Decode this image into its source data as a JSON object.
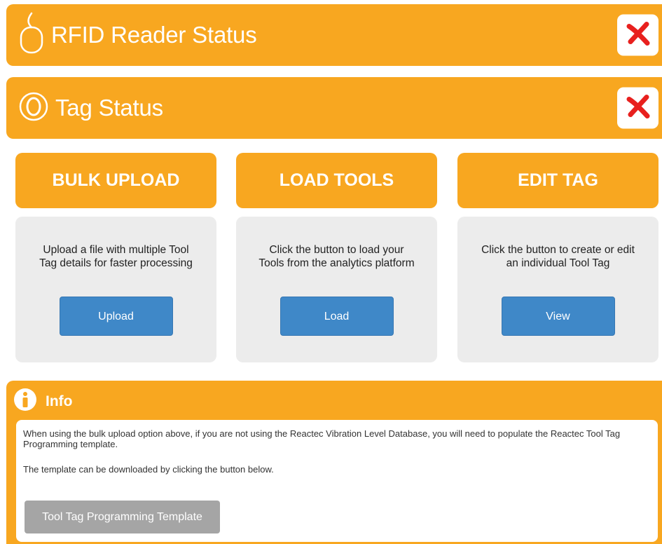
{
  "reader_status": {
    "title": "RFID Reader Status",
    "icon": "reader-icon",
    "status_icon": "red-x-icon"
  },
  "tag_status": {
    "title": "Tag Status",
    "icon": "tag-icon",
    "status_icon": "red-x-icon"
  },
  "cards": [
    {
      "title": "BULK UPLOAD",
      "line1": "Upload a file with multiple Tool",
      "line2": "Tag details for faster processing",
      "button": "Upload"
    },
    {
      "title": "LOAD TOOLS",
      "line1": "Click the button to load your",
      "line2": "Tools from the analytics platform",
      "button": "Load"
    },
    {
      "title": "EDIT TAG",
      "line1": "Click the button to create or edit",
      "line2": "an individual Tool Tag",
      "button": "View"
    }
  ],
  "info": {
    "title": "Info",
    "paragraph1": "When using the bulk upload option above, if you are not using the Reactec Vibration Level Database, you will need to populate the Reactec Tool Tag Programming template.",
    "paragraph2": "The template can be downloaded by clicking the button below.",
    "button": "Tool Tag Programming Template"
  },
  "colors": {
    "accent": "#f8a720",
    "button_blue": "#3f88c8",
    "card_bg": "#ececec",
    "error_red": "#e8201e",
    "disabled_gray": "#a5a5a5"
  }
}
